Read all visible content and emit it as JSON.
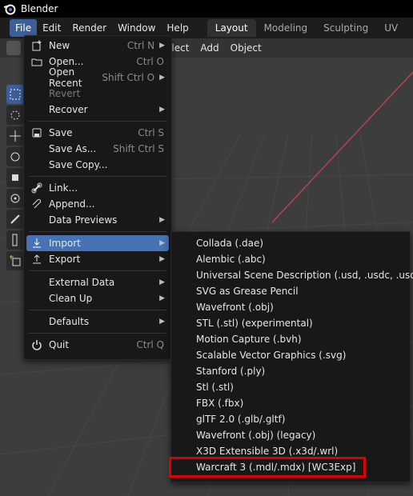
{
  "window": {
    "title": "Blender"
  },
  "menubar": {
    "items": [
      "File",
      "Edit",
      "Render",
      "Window",
      "Help"
    ],
    "workspaces": [
      "Layout",
      "Modeling",
      "Sculpting",
      "UV Editing"
    ]
  },
  "viewport_header": {
    "items": [
      "elect",
      "Add",
      "Object"
    ]
  },
  "file_menu": [
    {
      "label": "New",
      "shortcut": "Ctrl N",
      "arrow": "▶"
    },
    {
      "label": "Open...",
      "shortcut": "Ctrl O"
    },
    {
      "label": "Open Recent",
      "shortcut": "Shift Ctrl O",
      "arrow": "▶"
    },
    {
      "label": "Revert"
    },
    {
      "label": "Recover",
      "arrow": "▶"
    },
    {
      "label": "Save",
      "shortcut": "Ctrl S"
    },
    {
      "label": "Save As...",
      "shortcut": "Shift Ctrl S"
    },
    {
      "label": "Save Copy..."
    },
    {
      "label": "Link..."
    },
    {
      "label": "Append..."
    },
    {
      "label": "Data Previews",
      "arrow": "▶"
    },
    {
      "label": "Import",
      "arrow": "▶"
    },
    {
      "label": "Export",
      "arrow": "▶"
    },
    {
      "label": "External Data",
      "arrow": "▶"
    },
    {
      "label": "Clean Up",
      "arrow": "▶"
    },
    {
      "label": "Defaults",
      "arrow": "▶"
    },
    {
      "label": "Quit",
      "shortcut": "Ctrl Q"
    }
  ],
  "import_menu": [
    "Collada (.dae)",
    "Alembic (.abc)",
    "Universal Scene Description (.usd, .usdc, .usda)",
    "SVG as Grease Pencil",
    "Wavefront (.obj)",
    "STL (.stl) (experimental)",
    "Motion Capture (.bvh)",
    "Scalable Vector Graphics (.svg)",
    "Stanford (.ply)",
    "Stl (.stl)",
    "FBX (.fbx)",
    "glTF 2.0 (.glb/.gltf)",
    "Wavefront (.obj) (legacy)",
    "X3D Extensible 3D (.x3d/.wrl)",
    "Warcraft 3 (.mdl/.mdx) [WC3Exp]"
  ],
  "colors": {
    "active_menu": "#4772b3",
    "menu_bg": "#181818",
    "highlight_box": "#e00000",
    "x_axis": "#b8424a"
  }
}
